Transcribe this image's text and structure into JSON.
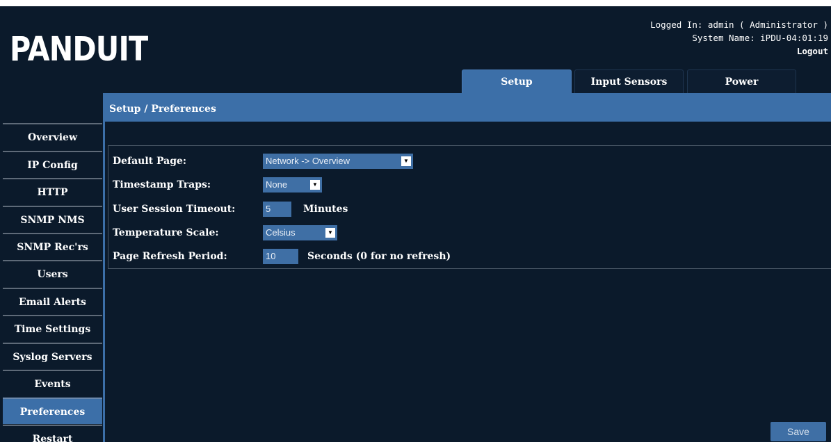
{
  "header": {
    "logo": "PANDUIT",
    "logged_in": "Logged In: admin ( Administrator )",
    "system_name": "System Name: iPDU-04:01:19",
    "logout": "Logout"
  },
  "tabs": [
    {
      "label": "Setup",
      "active": true
    },
    {
      "label": "Input Sensors",
      "active": false
    },
    {
      "label": "Power",
      "active": false
    }
  ],
  "sidebar": {
    "items": [
      {
        "label": "Overview"
      },
      {
        "label": "IP Config"
      },
      {
        "label": "HTTP"
      },
      {
        "label": "SNMP NMS"
      },
      {
        "label": "SNMP Rec'rs"
      },
      {
        "label": "Users"
      },
      {
        "label": "Email Alerts"
      },
      {
        "label": "Time Settings"
      },
      {
        "label": "Syslog Servers"
      },
      {
        "label": "Events"
      },
      {
        "label": "Preferences",
        "active": true
      },
      {
        "label": "Restart"
      }
    ]
  },
  "main": {
    "title": "Setup / Preferences",
    "fields": {
      "default_page": {
        "label": "Default Page:",
        "value": "Network -> Overview"
      },
      "timestamp_traps": {
        "label": "Timestamp Traps:",
        "value": "None"
      },
      "session_timeout": {
        "label": "User Session Timeout:",
        "value": "5",
        "unit": "Minutes"
      },
      "temperature_scale": {
        "label": "Temperature Scale:",
        "value": "Celsius"
      },
      "refresh_period": {
        "label": "Page Refresh Period:",
        "value": "10",
        "unit": "Seconds (0 for no refresh)"
      }
    },
    "save_label": "Save"
  },
  "colors": {
    "background": "#0b1a2b",
    "accent": "#3c6fa8",
    "field": "#3f6fa5"
  }
}
